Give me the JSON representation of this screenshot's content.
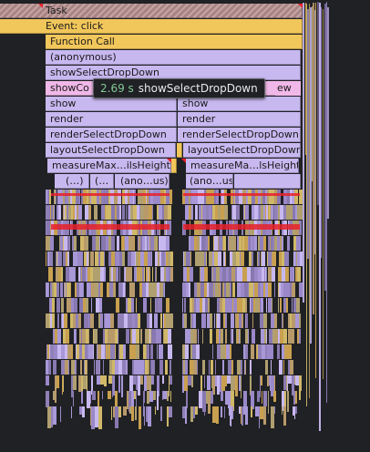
{
  "flame_chart": {
    "rows": {
      "task": "Task",
      "event": "Event: click",
      "function_call": "Function Call",
      "anonymous": "(anonymous)",
      "show_select_dropdown": "showSelectDropDown",
      "show_con": "showCo",
      "show_right": "ew",
      "show_left": "show",
      "show_right2": "show",
      "render_left": "render",
      "render_right": "render",
      "render_select_left": "renderSelectDropDown",
      "render_select_right": "renderSelectDropDown",
      "layout_select_left": "layoutSelectDropDown",
      "layout_select_right": "layoutSelectDropDown",
      "measure_left": "measureMax…ilsHeight",
      "measure_right": "measureMa…lsHeight",
      "sub_left_1": "(…)",
      "sub_left_2": "(…",
      "sub_left_3": "(ano…us)",
      "sub_right_1": "(ano…us)"
    },
    "tooltip": {
      "duration": "2.69 s",
      "name": "showSelectDropDown"
    },
    "colors": {
      "background": "#202124",
      "task": "#b89494",
      "event": "#f1c65a",
      "function": "#c8b8f0",
      "highlight": "#f0b8e8",
      "long_task_marker": "#e8202a",
      "tooltip_duration": "#81c995"
    }
  }
}
